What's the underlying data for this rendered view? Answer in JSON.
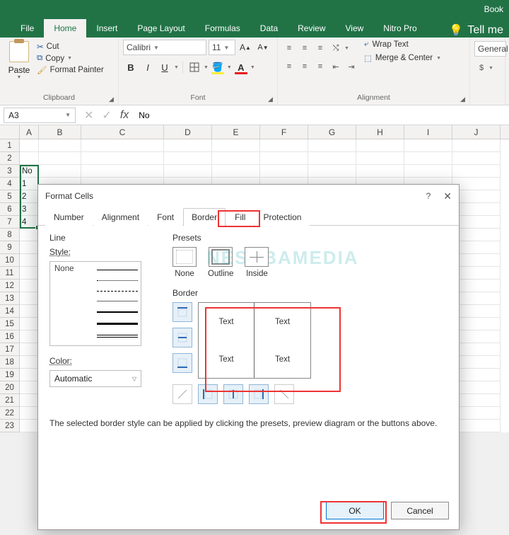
{
  "titlebar": {
    "doc": "Book"
  },
  "ribbon": {
    "tabs": [
      "File",
      "Home",
      "Insert",
      "Page Layout",
      "Formulas",
      "Data",
      "Review",
      "View",
      "Nitro Pro"
    ],
    "active": 1,
    "tell_me": "Tell me"
  },
  "clipboard": {
    "paste": "Paste",
    "cut": "Cut",
    "copy": "Copy",
    "format_painter": "Format Painter",
    "group": "Clipboard"
  },
  "font": {
    "name": "Calibri",
    "size": "11",
    "group": "Font"
  },
  "alignment": {
    "wrap": "Wrap Text",
    "merge": "Merge & Center",
    "group": "Alignment"
  },
  "number": {
    "format": "General"
  },
  "namebox": "A3",
  "formula": "No",
  "columns": [
    "A",
    "B",
    "C",
    "D",
    "E",
    "F",
    "G",
    "H",
    "I",
    "J"
  ],
  "row_numbers": [
    "1",
    "2",
    "3",
    "4",
    "5",
    "6",
    "7",
    "8",
    "9",
    "10",
    "11",
    "12",
    "13",
    "14",
    "15",
    "16",
    "17",
    "18",
    "19",
    "20",
    "21",
    "22",
    "23"
  ],
  "cells": {
    "A3": "No",
    "A4": "1",
    "A5": "2",
    "A6": "3",
    "A7": "4"
  },
  "dialog": {
    "title": "Format Cells",
    "tabs": [
      "Number",
      "Alignment",
      "Font",
      "Border",
      "Fill",
      "Protection"
    ],
    "line": "Line",
    "style": "Style:",
    "style_none": "None",
    "color": "Color:",
    "color_auto": "Automatic",
    "presets_label": "Presets",
    "preset_none": "None",
    "preset_outline": "Outline",
    "preset_inside": "Inside",
    "border_label": "Border",
    "preview_text": "Text",
    "description": "The selected border style can be applied by clicking the presets, preview diagram or the buttons above.",
    "ok": "OK",
    "cancel": "Cancel"
  },
  "watermark": "NESABAMEDIA"
}
